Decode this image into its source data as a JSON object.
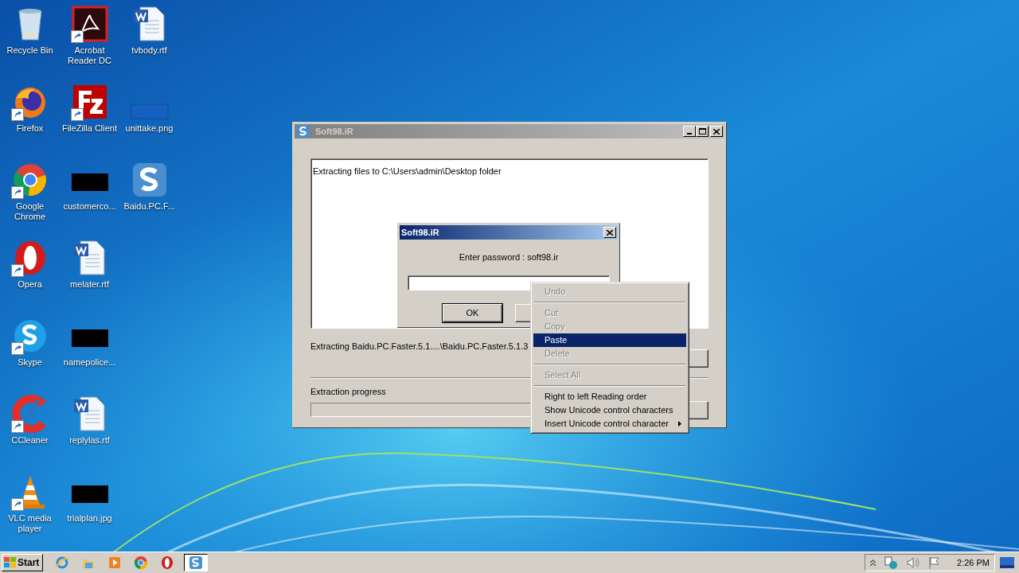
{
  "desktop_icons": [
    {
      "label": "Recycle Bin",
      "kind": "recycle",
      "shortcut": false
    },
    {
      "label": "Firefox",
      "kind": "firefox",
      "shortcut": true
    },
    {
      "label": "Google Chrome",
      "kind": "chrome",
      "shortcut": true
    },
    {
      "label": "Opera",
      "kind": "opera",
      "shortcut": true
    },
    {
      "label": "Skype",
      "kind": "skype",
      "shortcut": true
    },
    {
      "label": "CCleaner",
      "kind": "ccleaner",
      "shortcut": true
    },
    {
      "label": "VLC media player",
      "kind": "vlc",
      "shortcut": true
    },
    {
      "label": "Acrobat Reader DC",
      "kind": "acrobat",
      "shortcut": true
    },
    {
      "label": "FileZilla Client",
      "kind": "filezilla",
      "shortcut": true
    },
    {
      "label": "customerco...",
      "kind": "thumbnail",
      "shortcut": false
    },
    {
      "label": "melater.rtf",
      "kind": "document",
      "shortcut": false
    },
    {
      "label": "namepolice...",
      "kind": "thumbnail",
      "shortcut": false
    },
    {
      "label": "replylas.rtf",
      "kind": "document",
      "shortcut": false
    },
    {
      "label": "trialplan.jpg",
      "kind": "thumbnail",
      "shortcut": false
    },
    {
      "label": "tvbody.rtf",
      "kind": "document",
      "shortcut": false
    },
    {
      "label": "unittake.png",
      "kind": "faint",
      "shortcut": false
    },
    {
      "label": "Baidu.PC.F...",
      "kind": "soft98",
      "shortcut": false
    }
  ],
  "main_window": {
    "title": "Soft98.iR",
    "log_text": "Extracting files to C:\\Users\\admin\\Desktop folder",
    "status_text": "Extracting Baidu.PC.Faster.5.1....\\Baidu.PC.Faster.5.1.3",
    "progress_label": "Extraction progress",
    "progress": {
      "level": 0
    }
  },
  "password_dialog": {
    "title": "Soft98.iR",
    "prompt": "Enter password : soft98.ir",
    "ok_button": "OK"
  },
  "context_menu": [
    {
      "kind": "item",
      "label": "Undo",
      "disabled": true,
      "selected": false,
      "submenu": false
    },
    {
      "kind": "separator"
    },
    {
      "kind": "item",
      "label": "Cut",
      "disabled": true,
      "selected": false,
      "submenu": false
    },
    {
      "kind": "item",
      "label": "Copy",
      "disabled": true,
      "selected": false,
      "submenu": false
    },
    {
      "kind": "item",
      "label": "Paste",
      "disabled": false,
      "selected": true,
      "submenu": false
    },
    {
      "kind": "item",
      "label": "Delete",
      "disabled": true,
      "selected": false,
      "submenu": false
    },
    {
      "kind": "separator"
    },
    {
      "kind": "item",
      "label": "Select All",
      "disabled": true,
      "selected": false,
      "submenu": false
    },
    {
      "kind": "separator"
    },
    {
      "kind": "item",
      "label": "Right to left Reading order",
      "disabled": false,
      "selected": false,
      "submenu": false
    },
    {
      "kind": "item",
      "label": "Show Unicode control characters",
      "disabled": false,
      "selected": false,
      "submenu": false
    },
    {
      "kind": "item",
      "label": "Insert Unicode control character",
      "disabled": false,
      "selected": false,
      "submenu": true
    }
  ],
  "taskbar": {
    "start": "Start",
    "apps": [
      {
        "kind": "ie",
        "selected": false
      },
      {
        "kind": "folder",
        "selected": false
      },
      {
        "kind": "media",
        "selected": false
      },
      {
        "kind": "chrome",
        "selected": false
      },
      {
        "kind": "opera",
        "selected": false
      },
      {
        "kind": "soft98",
        "selected": true
      }
    ],
    "clock": "2:26 PM"
  }
}
